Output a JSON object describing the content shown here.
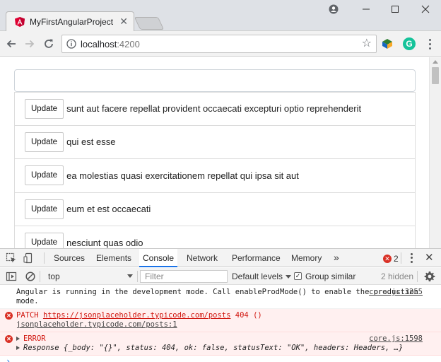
{
  "browser": {
    "tab_title": "MyFirstAngularProject",
    "url_host": "localhost",
    "url_port": ":4200",
    "extension_label": "G"
  },
  "page": {
    "search_placeholder": "",
    "update_label": "Update",
    "posts": [
      "sunt aut facere repellat provident occaecati excepturi optio reprehenderit",
      "qui est esse",
      "ea molestias quasi exercitationem repellat qui ipsa sit aut",
      "eum et est occaecati",
      "nesciunt quas odio"
    ]
  },
  "devtools": {
    "tabs": [
      "Sources",
      "Elements",
      "Console",
      "Network",
      "Performance",
      "Memory"
    ],
    "active_tab": "Console",
    "more": "»",
    "error_count": "2",
    "context": "top",
    "filter_placeholder": "Filter",
    "levels": "Default levels",
    "group_similar": "Group similar",
    "hidden": "2 hidden",
    "messages": [
      {
        "text": "Angular is running in the development mode. Call enableProdMode() to enable the production mode.",
        "source": "core.js:3255"
      },
      {
        "method": "PATCH",
        "url": "https://jsonplaceholder.typicode.com/posts",
        "status": "404 ()",
        "source": "jsonplaceholder.typicode.com/posts:1"
      },
      {
        "label": "ERROR",
        "source": "core.js:1598"
      },
      {
        "response": "Response {_body: \"{}\", status: 404, ok: false, statusText: \"OK\", headers: Headers, …}"
      }
    ],
    "prompt": "›"
  },
  "colors": {
    "accent": "#1a73e8",
    "error": "#d93025",
    "angular_red": "#dd0031",
    "grammarly": "#15c39a"
  }
}
